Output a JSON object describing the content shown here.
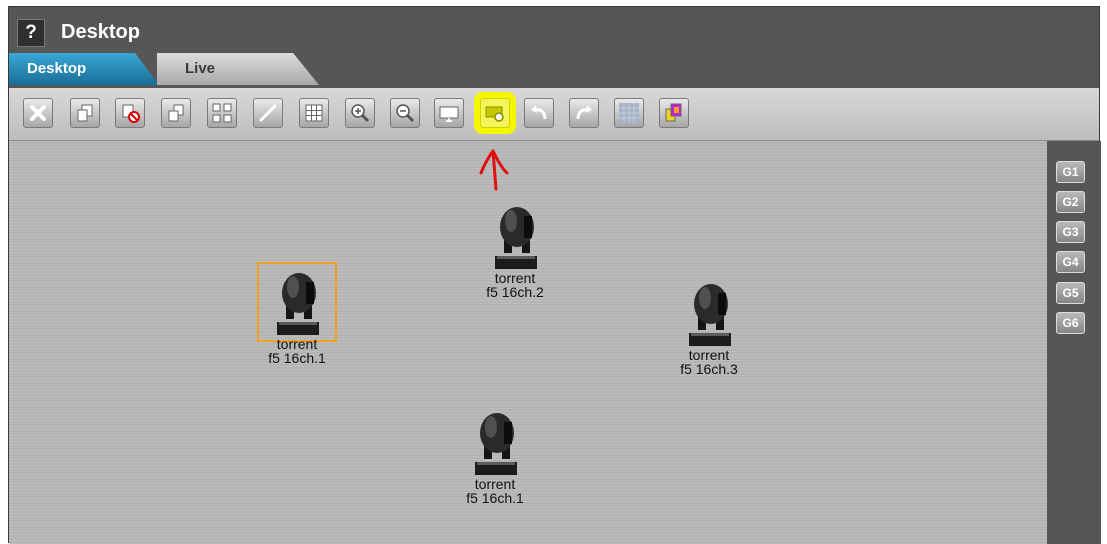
{
  "window": {
    "help_label": "?",
    "title": "Desktop"
  },
  "tabs": [
    {
      "label": "Desktop",
      "active": true
    },
    {
      "label": "Live",
      "active": false
    }
  ],
  "toolbar": {
    "buttons": [
      {
        "icon": "close-icon",
        "active": false
      },
      {
        "icon": "copy-icon",
        "active": false
      },
      {
        "icon": "remove-copy-icon",
        "active": false
      },
      {
        "icon": "duplicate-icon",
        "active": false
      },
      {
        "icon": "arrange-grid-icon",
        "active": false
      },
      {
        "icon": "pencil-icon",
        "active": false
      },
      {
        "icon": "grid-icon",
        "active": false
      },
      {
        "icon": "zoom-in-icon",
        "active": false
      },
      {
        "icon": "zoom-out-icon",
        "active": false
      },
      {
        "icon": "monitor-icon",
        "active": false
      },
      {
        "icon": "screenshot-icon",
        "active": true,
        "highlight_color": "#f4f700"
      },
      {
        "icon": "undo-icon",
        "active": false
      },
      {
        "icon": "redo-icon",
        "active": false
      },
      {
        "icon": "pattern-icon",
        "active": false
      },
      {
        "icon": "color-layers-icon",
        "active": false
      }
    ]
  },
  "groups": [
    "G1",
    "G2",
    "G3",
    "G4",
    "G5",
    "G6"
  ],
  "fixtures": [
    {
      "line1": "torrent",
      "line2": "f5 16ch.1",
      "selected": true
    },
    {
      "line1": "torrent",
      "line2": "f5 16ch.2",
      "selected": false
    },
    {
      "line1": "torrent",
      "line2": "f5 16ch.3",
      "selected": false
    },
    {
      "line1": "torrent",
      "line2": "f5 16ch.1",
      "selected": false
    }
  ],
  "annotation": {
    "color": "#e01010"
  },
  "colors": {
    "tab_active": "#2a8dbb",
    "selection": "#f0a020",
    "highlight": "#f4f700"
  }
}
